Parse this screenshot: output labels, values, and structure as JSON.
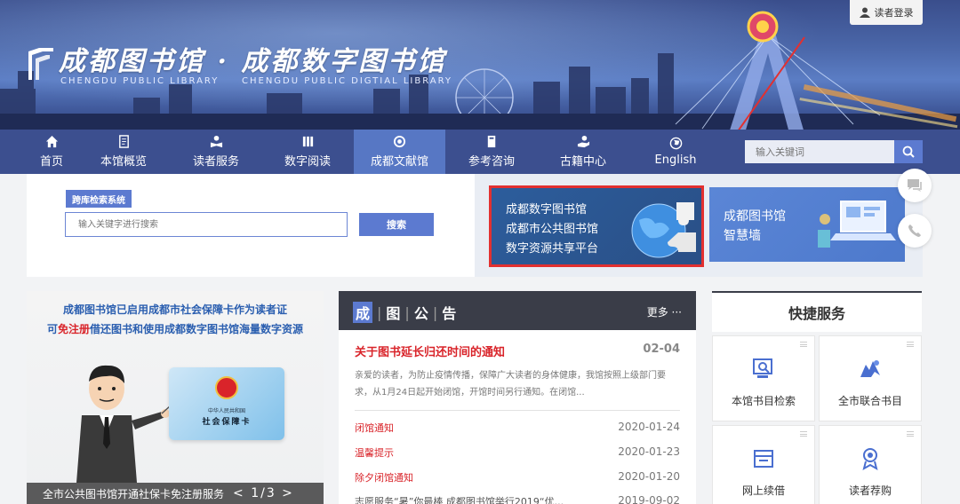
{
  "header": {
    "logo_title": "成都图书馆 · 成都数字图书馆",
    "sub_left": "CHENGDU PUBLIC LIBRARY",
    "sub_right": "CHENGDU PUBLIC DIGTIAL LIBRARY",
    "login_label": "读者登录"
  },
  "nav": {
    "items": [
      {
        "label": "首页",
        "icon": "home-icon"
      },
      {
        "label": "本馆概览",
        "icon": "document-icon"
      },
      {
        "label": "读者服务",
        "icon": "reader-icon"
      },
      {
        "label": "数字阅读",
        "icon": "books-icon"
      },
      {
        "label": "成都文献馆",
        "icon": "circle-icon"
      },
      {
        "label": "参考咨询",
        "icon": "book-icon"
      },
      {
        "label": "古籍中心",
        "icon": "hand-icon"
      },
      {
        "label": "English",
        "icon": "globe-icon"
      }
    ],
    "active_index": 4,
    "search_placeholder": "输入关键词"
  },
  "cross_search": {
    "tab_label": "跨库检索系统",
    "placeholder": "输入关键字进行搜索",
    "button_label": "搜索"
  },
  "promos": {
    "digital": {
      "lines": [
        "成都数字图书馆",
        "成都市公共图书馆",
        "数字资源共享平台"
      ]
    },
    "smart": {
      "lines": [
        "成都图书馆",
        "智慧墙"
      ]
    }
  },
  "left_promo": {
    "line1": "成都图书馆已启用成都市社会保障卡作为读者证",
    "line2_prefix": "可",
    "line2_highlight": "免注册",
    "line2_suffix": "借还图书和使用成都数字图书馆海量数字资源",
    "card_line1": "中华人民共和国",
    "card_line2": "社会保障卡",
    "caption": "全市公共图书馆开通社保卡免注册服务",
    "pager": "< 1/3 >"
  },
  "notice": {
    "title_chars": [
      "成",
      "图",
      "公",
      "告"
    ],
    "more_label": "更多 ···",
    "top": {
      "title": "关于图书延长归还时间的通知",
      "date": "02-04",
      "desc": "亲爱的读者，为防止疫情传播，保障广大读者的身体健康，我馆按照上级部门要求，从1月24日起开始闭馆，开馆时间另行通知。在闭馆..."
    },
    "items": [
      {
        "title": "闭馆通知",
        "date": "2020-01-24"
      },
      {
        "title": "温馨提示",
        "date": "2020-01-23"
      },
      {
        "title": "除夕闭馆通知",
        "date": "2020-01-20"
      },
      {
        "title": "志愿服务“暑”你最棒 成都图书馆举行2019“优...",
        "date": "2019-09-02"
      }
    ]
  },
  "quick": {
    "title": "快捷服务",
    "items": [
      {
        "label": "本馆书目检索",
        "icon": "catalog-search-icon"
      },
      {
        "label": "全市联合书目",
        "icon": "union-catalog-icon"
      },
      {
        "label": "网上续借",
        "icon": "renew-icon"
      },
      {
        "label": "读者荐购",
        "icon": "recommend-icon"
      }
    ]
  },
  "colors": {
    "nav_bg": "#3c4f8f",
    "nav_active": "#5777c4",
    "accent": "#5c7ad0",
    "alert_red": "#d9242a",
    "highlight_border": "#e23030"
  }
}
